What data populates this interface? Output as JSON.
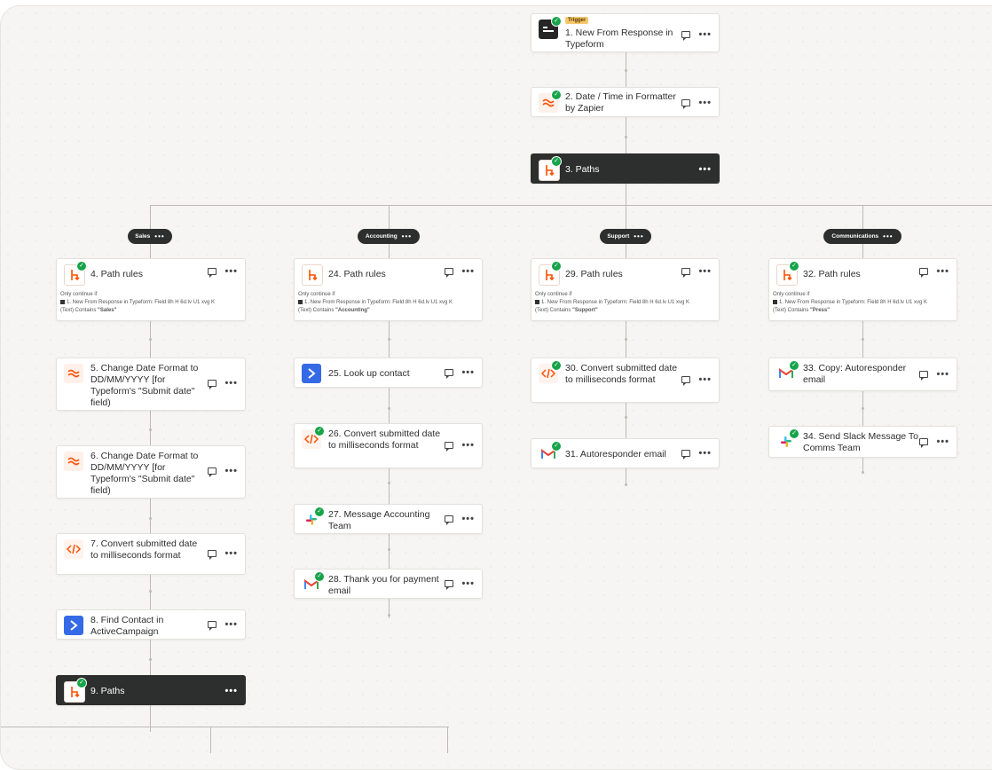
{
  "canvas": {
    "background": "#f6f5f3",
    "wire_color": "#bdbab5",
    "success_color": "#17a34a",
    "accent": "#ff4f00"
  },
  "trigger": {
    "badge": "Trigger",
    "title": "1. New From Response in Typeform",
    "icon": "typeform-icon"
  },
  "step2": {
    "title": "2. Date / Time in Formatter by Zapier",
    "icon": "formatter-icon"
  },
  "step3": {
    "title": "3. Paths",
    "icon": "paths-icon"
  },
  "branches": {
    "sales": "Sales",
    "accounting": "Accounting",
    "support": "Support",
    "communications": "Communications"
  },
  "sales": {
    "rules_title": "4. Path rules",
    "rules_prefix": "Only continue if",
    "rules_field": "1. New From Response in Typeform: Field 8h H 6d.lv U1 xvg K",
    "rules_cond": "(Text) Contains",
    "rules_value": "\"Sales\"",
    "s5": "5. Change Date Format to DD/MM/YYYY [for Typeform's \"Submit date\" field)",
    "s6": "6. Change Date Format to DD/MM/YYYY [for Typeform's \"Submit date\" field)",
    "s7": "7. Convert submitted date to milliseconds format",
    "s8": "8. Find Contact in ActiveCampaign",
    "s9": "9. Paths"
  },
  "accounting": {
    "rules_title": "24. Path rules",
    "rules_prefix": "Only continue if",
    "rules_field": "1. New From Response in Typeform: Field 8h H 6d.lv U1 xvg K",
    "rules_cond": "(Text) Contains",
    "rules_value": "\"Accounting\"",
    "s25": "25. Look up contact",
    "s26": "26. Convert submitted date to milliseconds format",
    "s27": "27. Message Accounting Team",
    "s28": "28. Thank you for payment email"
  },
  "support": {
    "rules_title": "29. Path rules",
    "rules_prefix": "Only continue if",
    "rules_field": "1. New From Response in Typeform: Field 8h H 6d.lv U1 xvg K",
    "rules_cond": "(Text) Contains",
    "rules_value": "\"Support\"",
    "s30": "30. Convert submitted date to milliseconds format",
    "s31": "31. Autoresponder email"
  },
  "communications": {
    "rules_title": "32. Path rules",
    "rules_prefix": "Only continue if",
    "rules_field": "1. New From Response in Typeform: Field 8h H 6d.lv U1 xvg K",
    "rules_cond": "(Text) Contains",
    "rules_value": "\"Press\"",
    "s33": "33. Copy: Autoresponder email",
    "s34": "34. Send Slack Message To Comms Team"
  },
  "icons": {
    "comment": "comment-icon",
    "more": "more-options-icon",
    "more_glyph": "•••",
    "check": "✓"
  }
}
